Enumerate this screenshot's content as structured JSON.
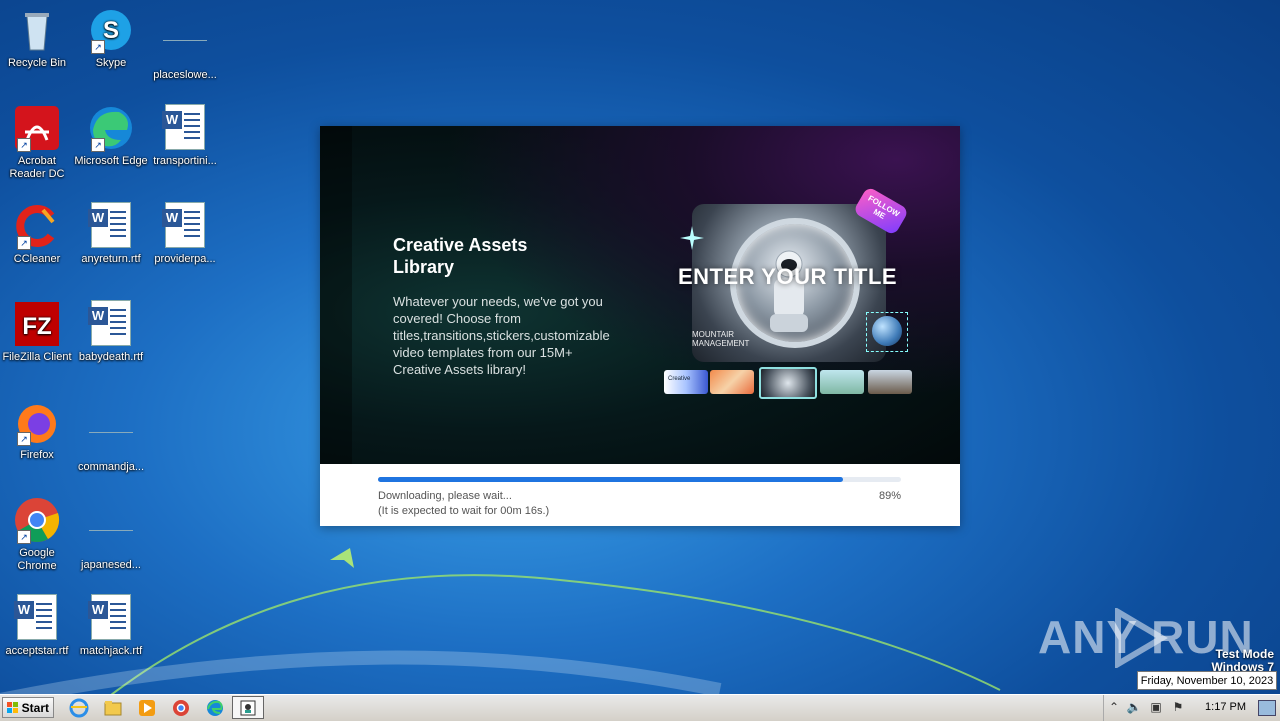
{
  "desktop": {
    "icons": [
      {
        "label": "Recycle Bin",
        "icon": "recycle-bin-icon"
      },
      {
        "label": "Skype",
        "icon": "skype-icon"
      },
      {
        "label": "placeslowe...",
        "icon": "blank-file-icon"
      },
      {
        "label": "Acrobat Reader DC",
        "icon": "acrobat-icon"
      },
      {
        "label": "Microsoft Edge",
        "icon": "edge-icon"
      },
      {
        "label": "transportini...",
        "icon": "word-doc-icon"
      },
      {
        "label": "CCleaner",
        "icon": "ccleaner-icon"
      },
      {
        "label": "anyreturn.rtf",
        "icon": "word-doc-icon"
      },
      {
        "label": "providerpa...",
        "icon": "word-doc-icon"
      },
      {
        "label": "FileZilla Client",
        "icon": "filezilla-icon"
      },
      {
        "label": "babydeath.rtf",
        "icon": "word-doc-icon"
      },
      {
        "label": "Firefox",
        "icon": "firefox-icon"
      },
      {
        "label": "commandja...",
        "icon": "blank-file-icon"
      },
      {
        "label": "Google Chrome",
        "icon": "chrome-icon"
      },
      {
        "label": "japanesed...",
        "icon": "blank-file-icon"
      },
      {
        "label": "acceptstar.rtf",
        "icon": "word-doc-icon"
      },
      {
        "label": "matchjack.rtf",
        "icon": "word-doc-icon"
      }
    ]
  },
  "installer": {
    "promo_title": "Creative Assets Library",
    "promo_description": "Whatever your needs, we've got you covered! Choose from titles,transitions,stickers,customizable video templates from our 15M+ Creative Assets library!",
    "preview_title": "ENTER YOUR TITLE",
    "preview_badge": "FOLLOW ME",
    "preview_subtext": "MOUNTAIR MANAGEMENT",
    "thumb_label": "Creative",
    "status": "Downloading, please wait...",
    "wait_text": "(It is expected to wait for 00m 16s.)",
    "percent_text": "89%",
    "progress": 0.89,
    "progress_color": "#1f74e0"
  },
  "watermark": {
    "text": "ANY RUN",
    "test_mode": "Test Mode",
    "os": "Windows 7"
  },
  "taskbar": {
    "start_label": "Start",
    "items": [
      "internet-explorer-icon",
      "file-explorer-icon",
      "media-player-icon",
      "chrome-icon",
      "edge-icon",
      "installer-app-icon"
    ],
    "clock": "1:17 PM",
    "date_tooltip": "Friday, November 10, 2023"
  }
}
